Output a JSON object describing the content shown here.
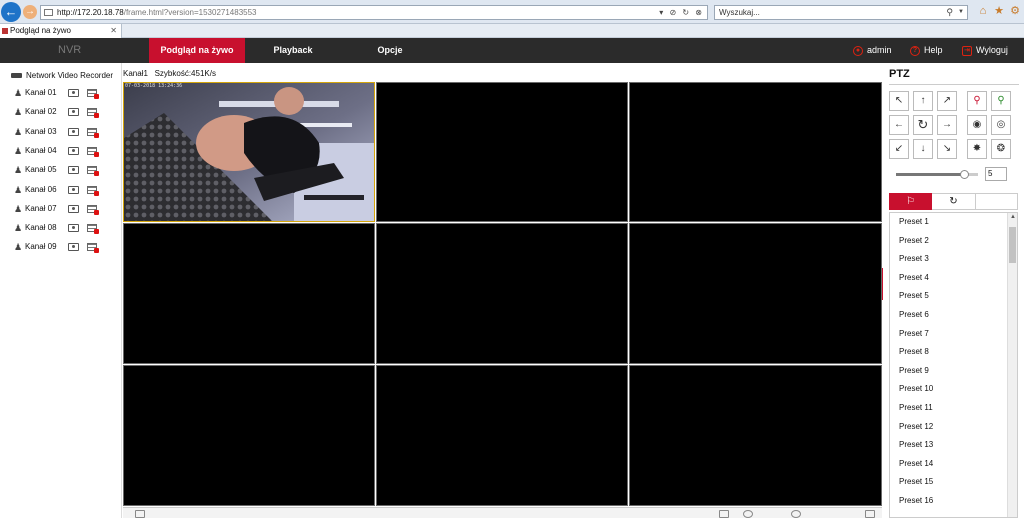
{
  "browser": {
    "url_host": "http://172.20.18.78",
    "url_path": "/frame.html?version=1530271483553",
    "search_placeholder": "Wyszukaj...",
    "tab_title": "Podgląd na żywo"
  },
  "header": {
    "logo": "NVR",
    "nav": [
      {
        "label": "Podgląd na żywo",
        "active": true
      },
      {
        "label": "Playback",
        "active": false
      },
      {
        "label": "Opcje",
        "active": false
      }
    ],
    "user": "admin",
    "help": "Help",
    "logout": "Wyloguj"
  },
  "sidebar": {
    "device": "Network Video Recorder",
    "channels": [
      "Kanał 01",
      "Kanał 02",
      "Kanał 03",
      "Kanał 04",
      "Kanał 05",
      "Kanał 06",
      "Kanał 07",
      "Kanał 08",
      "Kanał 09"
    ]
  },
  "video": {
    "channel": "Kanał1",
    "bitrate": "Szybkość:451K/s",
    "overlay_date": "07-03-2018 13:24:36",
    "layout": "3x3"
  },
  "ptz": {
    "title": "PTZ",
    "speed": "5",
    "speed_fraction": 0.83,
    "presets": [
      "Preset 1",
      "Preset 2",
      "Preset 3",
      "Preset 4",
      "Preset 5",
      "Preset 6",
      "Preset 7",
      "Preset 8",
      "Preset 9",
      "Preset 10",
      "Preset 11",
      "Preset 12",
      "Preset 13",
      "Preset 14",
      "Preset 15",
      "Preset 16"
    ]
  },
  "colors": {
    "accent": "#c8102e",
    "header_bg": "#2b2b2b",
    "selected_border": "#d4a60c"
  }
}
